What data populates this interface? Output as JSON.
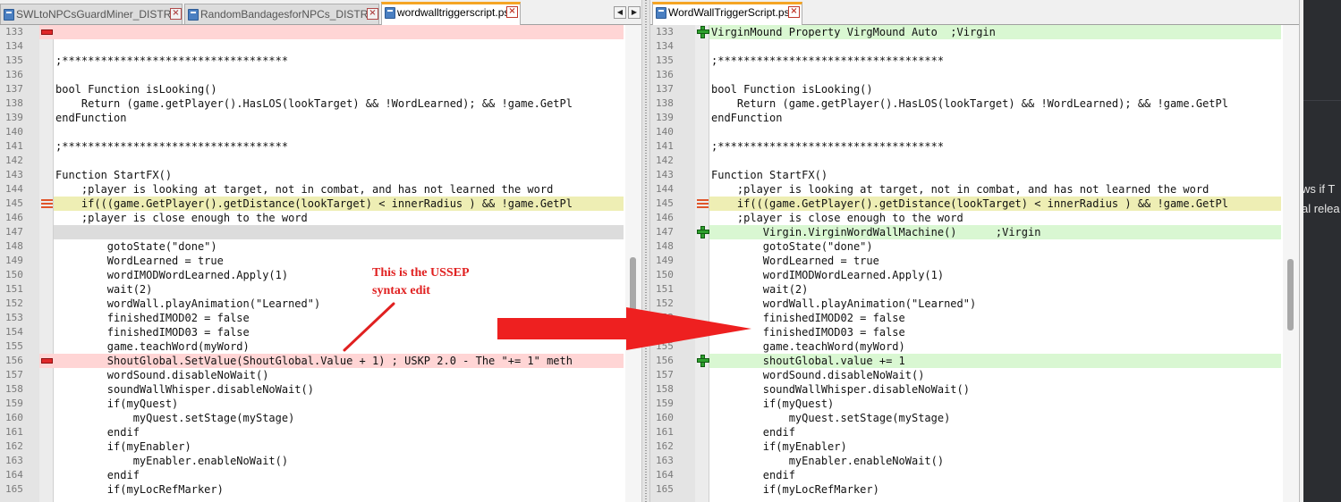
{
  "colors": {
    "removed_bg": "#ffd5d5",
    "added_bg": "#d9f7d2",
    "changed_bg": "#eeeeb4",
    "annotation_red": "#e02020",
    "tab_accent": "#f5a524"
  },
  "left": {
    "tabs": [
      {
        "label": "SWLtoNPCsGuardMiner_DISTRI.ini",
        "active": false
      },
      {
        "label": "RandomBandagesforNPCs_DISTRI.ini",
        "active": false
      },
      {
        "label": "wordwalltriggerscript.psc",
        "active": true
      }
    ],
    "lines": [
      {
        "n": "133",
        "text": "",
        "state": "removed",
        "marker": "minus"
      },
      {
        "n": "134",
        "text": "",
        "state": "",
        "marker": ""
      },
      {
        "n": "135",
        "text": ";***********************************",
        "state": "",
        "marker": ""
      },
      {
        "n": "136",
        "text": "",
        "state": "",
        "marker": ""
      },
      {
        "n": "137",
        "text": "bool Function isLooking()",
        "state": "",
        "marker": ""
      },
      {
        "n": "138",
        "text": "    Return (game.getPlayer().HasLOS(lookTarget) && !WordLearned); && !game.GetPl",
        "state": "",
        "marker": ""
      },
      {
        "n": "139",
        "text": "endFunction",
        "state": "",
        "marker": ""
      },
      {
        "n": "140",
        "text": "",
        "state": "",
        "marker": ""
      },
      {
        "n": "141",
        "text": ";***********************************",
        "state": "",
        "marker": ""
      },
      {
        "n": "142",
        "text": "",
        "state": "",
        "marker": ""
      },
      {
        "n": "143",
        "text": "Function StartFX()",
        "state": "",
        "marker": ""
      },
      {
        "n": "144",
        "text": "    ;player is looking at target, not in combat, and has not learned the word",
        "state": "",
        "marker": ""
      },
      {
        "n": "145",
        "text": "    if(((game.GetPlayer().getDistance(lookTarget) < innerRadius ) && !game.GetPl",
        "state": "changed",
        "marker": "change"
      },
      {
        "n": "146",
        "text": "    ;player is close enough to the word",
        "state": "",
        "marker": ""
      },
      {
        "n": "147",
        "text": "",
        "state": "gap",
        "marker": ""
      },
      {
        "n": "148",
        "text": "        gotoState(\"done\")",
        "state": "",
        "marker": ""
      },
      {
        "n": "149",
        "text": "        WordLearned = true",
        "state": "",
        "marker": ""
      },
      {
        "n": "150",
        "text": "        wordIMODWordLearned.Apply(1)",
        "state": "",
        "marker": ""
      },
      {
        "n": "151",
        "text": "        wait(2)",
        "state": "",
        "marker": ""
      },
      {
        "n": "152",
        "text": "        wordWall.playAnimation(\"Learned\")",
        "state": "",
        "marker": ""
      },
      {
        "n": "153",
        "text": "        finishedIMOD02 = false",
        "state": "",
        "marker": ""
      },
      {
        "n": "154",
        "text": "        finishedIMOD03 = false",
        "state": "",
        "marker": ""
      },
      {
        "n": "155",
        "text": "        game.teachWord(myWord)",
        "state": "",
        "marker": ""
      },
      {
        "n": "156",
        "text": "        ShoutGlobal.SetValue(ShoutGlobal.Value + 1) ; USKP 2.0 - The \"+= 1\" meth",
        "state": "removed",
        "marker": "minus"
      },
      {
        "n": "157",
        "text": "        wordSound.disableNoWait()",
        "state": "",
        "marker": ""
      },
      {
        "n": "158",
        "text": "        soundWallWhisper.disableNoWait()",
        "state": "",
        "marker": ""
      },
      {
        "n": "159",
        "text": "        if(myQuest)",
        "state": "",
        "marker": ""
      },
      {
        "n": "160",
        "text": "            myQuest.setStage(myStage)",
        "state": "",
        "marker": ""
      },
      {
        "n": "161",
        "text": "        endif",
        "state": "",
        "marker": ""
      },
      {
        "n": "162",
        "text": "        if(myEnabler)",
        "state": "",
        "marker": ""
      },
      {
        "n": "163",
        "text": "            myEnabler.enableNoWait()",
        "state": "",
        "marker": ""
      },
      {
        "n": "164",
        "text": "        endif",
        "state": "",
        "marker": ""
      },
      {
        "n": "165",
        "text": "        if(myLocRefMarker)",
        "state": "",
        "marker": ""
      }
    ]
  },
  "right": {
    "tabs": [
      {
        "label": "WordWallTriggerScript.psc",
        "active": true
      }
    ],
    "lines": [
      {
        "n": "133",
        "text": "VirginMound Property VirgMound Auto  ;Virgin",
        "state": "added",
        "marker": "plus"
      },
      {
        "n": "134",
        "text": "",
        "state": "",
        "marker": ""
      },
      {
        "n": "135",
        "text": ";***********************************",
        "state": "",
        "marker": ""
      },
      {
        "n": "136",
        "text": "",
        "state": "",
        "marker": ""
      },
      {
        "n": "137",
        "text": "bool Function isLooking()",
        "state": "",
        "marker": ""
      },
      {
        "n": "138",
        "text": "    Return (game.getPlayer().HasLOS(lookTarget) && !WordLearned); && !game.GetPl",
        "state": "",
        "marker": ""
      },
      {
        "n": "139",
        "text": "endFunction",
        "state": "",
        "marker": ""
      },
      {
        "n": "140",
        "text": "",
        "state": "",
        "marker": ""
      },
      {
        "n": "141",
        "text": ";***********************************",
        "state": "",
        "marker": ""
      },
      {
        "n": "142",
        "text": "",
        "state": "",
        "marker": ""
      },
      {
        "n": "143",
        "text": "Function StartFX()",
        "state": "",
        "marker": ""
      },
      {
        "n": "144",
        "text": "    ;player is looking at target, not in combat, and has not learned the word",
        "state": "",
        "marker": ""
      },
      {
        "n": "145",
        "text": "    if(((game.GetPlayer().getDistance(lookTarget) < innerRadius ) && !game.GetPl",
        "state": "changed",
        "marker": "change"
      },
      {
        "n": "146",
        "text": "    ;player is close enough to the word",
        "state": "",
        "marker": ""
      },
      {
        "n": "147",
        "text": "        Virgin.VirginWordWallMachine()      ;Virgin",
        "state": "added",
        "marker": "plus"
      },
      {
        "n": "148",
        "text": "        gotoState(\"done\")",
        "state": "",
        "marker": ""
      },
      {
        "n": "149",
        "text": "        WordLearned = true",
        "state": "",
        "marker": ""
      },
      {
        "n": "150",
        "text": "        wordIMODWordLearned.Apply(1)",
        "state": "",
        "marker": ""
      },
      {
        "n": "151",
        "text": "        wait(2)",
        "state": "",
        "marker": ""
      },
      {
        "n": "152",
        "text": "        wordWall.playAnimation(\"Learned\")",
        "state": "",
        "marker": ""
      },
      {
        "n": "153",
        "text": "        finishedIMOD02 = false",
        "state": "",
        "marker": ""
      },
      {
        "n": "154",
        "text": "        finishedIMOD03 = false",
        "state": "",
        "marker": ""
      },
      {
        "n": "155",
        "text": "        game.teachWord(myWord)",
        "state": "",
        "marker": ""
      },
      {
        "n": "156",
        "text": "        shoutGlobal.value += 1",
        "state": "added",
        "marker": "plus"
      },
      {
        "n": "157",
        "text": "        wordSound.disableNoWait()",
        "state": "",
        "marker": ""
      },
      {
        "n": "158",
        "text": "        soundWallWhisper.disableNoWait()",
        "state": "",
        "marker": ""
      },
      {
        "n": "159",
        "text": "        if(myQuest)",
        "state": "",
        "marker": ""
      },
      {
        "n": "160",
        "text": "            myQuest.setStage(myStage)",
        "state": "",
        "marker": ""
      },
      {
        "n": "161",
        "text": "        endif",
        "state": "",
        "marker": ""
      },
      {
        "n": "162",
        "text": "        if(myEnabler)",
        "state": "",
        "marker": ""
      },
      {
        "n": "163",
        "text": "            myEnabler.enableNoWait()",
        "state": "",
        "marker": ""
      },
      {
        "n": "164",
        "text": "        endif",
        "state": "",
        "marker": ""
      },
      {
        "n": "165",
        "text": "        if(myLocRefMarker)",
        "state": "",
        "marker": ""
      }
    ]
  },
  "annotation": {
    "line1": "This is the USSEP",
    "line2": "syntax edit"
  },
  "side_panel": {
    "line1": "ws if T",
    "line2": "al relea"
  }
}
